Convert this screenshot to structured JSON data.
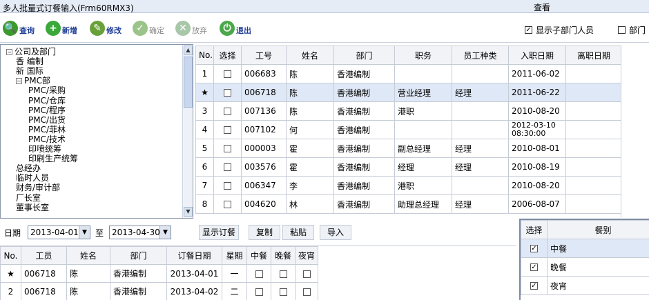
{
  "window": {
    "title": "多人批量式订餐输入(Frm60RMX3)",
    "query_title": "查看"
  },
  "toolbar": [
    {
      "label": "查询",
      "icon": "search-icon",
      "color": "#3a9a2c",
      "glyph": "🔍",
      "enabled": true
    },
    {
      "label": "新增",
      "icon": "add-icon",
      "color": "#3aa83a",
      "glyph": "+",
      "enabled": true
    },
    {
      "label": "修改",
      "icon": "edit-icon",
      "color": "#6aa03a",
      "glyph": "✎",
      "enabled": true
    },
    {
      "label": "确定",
      "icon": "confirm-icon",
      "color": "#9ac48a",
      "glyph": "✓",
      "enabled": false
    },
    {
      "label": "放弃",
      "icon": "cancel-icon",
      "color": "#a9c7a9",
      "glyph": "✕",
      "enabled": false
    },
    {
      "label": "退出",
      "icon": "exit-icon",
      "color": "#4aa84a",
      "glyph": "⏻",
      "enabled": true
    }
  ],
  "options": {
    "show_sub_dept": "显示子部门人员",
    "show_sub_dept_checked": true,
    "dept_option": "部门"
  },
  "tree": [
    {
      "label": "公司及部门",
      "level": 0,
      "expander": "−"
    },
    {
      "label": "香 编制",
      "level": 1
    },
    {
      "label": "新 国际",
      "level": 1
    },
    {
      "label": "PMC部",
      "level": 1,
      "expander": "−"
    },
    {
      "label": "PMC/采购",
      "level": 2
    },
    {
      "label": "PMC/仓库",
      "level": 2
    },
    {
      "label": "PMC/程序",
      "level": 2
    },
    {
      "label": "PMC/出货",
      "level": 2
    },
    {
      "label": "PMC/菲林",
      "level": 2
    },
    {
      "label": "PMC/技术",
      "level": 2
    },
    {
      "label": "印喷统筹",
      "level": 2
    },
    {
      "label": "印刷生产统筹",
      "level": 2
    },
    {
      "label": "总经办",
      "level": 1
    },
    {
      "label": "临时人员",
      "level": 1
    },
    {
      "label": "财务/审计部",
      "level": 1
    },
    {
      "label": "厂长室",
      "level": 1
    },
    {
      "label": "董事长室",
      "level": 1
    }
  ],
  "employees": {
    "columns": [
      "No.",
      "选择",
      "工号",
      "姓名",
      "部门",
      "职务",
      "员工种类",
      "入职日期",
      "离职日期"
    ],
    "rows": [
      {
        "no": "1",
        "emp_id": "006683",
        "name": "陈",
        "dept": "香港编制",
        "title": "",
        "type": "",
        "join": "2011-06-02",
        "leave": ""
      },
      {
        "no": "★",
        "emp_id": "006718",
        "name": "陈",
        "dept": "香港编制",
        "title": "营业经理",
        "type": "经理",
        "join": "2011-06-22",
        "leave": "",
        "selected": true
      },
      {
        "no": "3",
        "emp_id": "007136",
        "name": "陈",
        "dept": "香港编制",
        "title": "港职",
        "type": "",
        "join": "2010-08-20",
        "leave": ""
      },
      {
        "no": "4",
        "emp_id": "007102",
        "name": "何",
        "dept": "香港编制",
        "title": "",
        "type": "",
        "join": "2012-03-10 08:30:00",
        "leave": ""
      },
      {
        "no": "5",
        "emp_id": "000003",
        "name": "霍",
        "dept": "香港编制",
        "title": "副总经理",
        "type": "经理",
        "join": "2010-08-01",
        "leave": ""
      },
      {
        "no": "6",
        "emp_id": "003576",
        "name": "霍",
        "dept": "香港编制",
        "title": "经理",
        "type": "经理",
        "join": "2010-08-19",
        "leave": ""
      },
      {
        "no": "7",
        "emp_id": "006347",
        "name": "李",
        "dept": "香港编制",
        "title": "港职",
        "type": "",
        "join": "2010-08-20",
        "leave": ""
      },
      {
        "no": "8",
        "emp_id": "004620",
        "name": "林",
        "dept": "香港编制",
        "title": "助理总经理",
        "type": "经理",
        "join": "2006-08-07",
        "leave": ""
      }
    ]
  },
  "filter": {
    "date_label": "日期",
    "from": "2013-04-01",
    "to_label": "至",
    "to": "2013-04-30",
    "buttons": [
      "显示订餐",
      "复制",
      "粘贴",
      "导入"
    ]
  },
  "orders": {
    "columns": [
      "No.",
      "工员",
      "姓名",
      "部门",
      "订餐日期",
      "星期",
      "中餐",
      "晚餐",
      "夜宵"
    ],
    "rows": [
      {
        "no": "★",
        "emp_id": "006718",
        "name": "陈",
        "dept": "香港编制",
        "date": "2013-04-01",
        "weekday": "一"
      },
      {
        "no": "2",
        "emp_id": "006718",
        "name": "陈",
        "dept": "香港编制",
        "date": "2013-04-02",
        "weekday": "二"
      }
    ]
  },
  "meals": {
    "columns": [
      "选择",
      "餐别"
    ],
    "rows": [
      {
        "label": "中餐",
        "checked": true,
        "selected": true
      },
      {
        "label": "晚餐",
        "checked": true
      },
      {
        "label": "夜宵",
        "checked": true
      }
    ]
  }
}
